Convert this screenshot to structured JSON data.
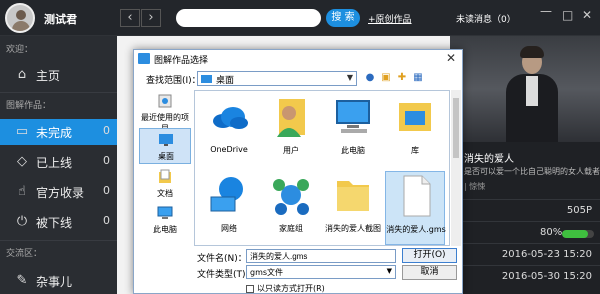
{
  "topbar": {
    "username": "测试君",
    "back_label": "‹",
    "forward_label": "›",
    "search_value": "",
    "search_button": "搜 索",
    "publish_link": "+原创作品",
    "unread": "未读消息（0）",
    "min_label": "—",
    "max_label": "□",
    "close_label": "✕"
  },
  "sidebar": {
    "welcome": "欢迎：",
    "home": "主页",
    "works_section": "图解作品：",
    "items": [
      {
        "label": "未完成",
        "count": "0",
        "icon": "monitor-icon"
      },
      {
        "label": "已上线",
        "count": "0",
        "icon": "tag-icon"
      },
      {
        "label": "官方收录",
        "count": "0",
        "icon": "thumb-up-icon"
      },
      {
        "label": "被下线",
        "count": "0",
        "icon": "power-icon"
      }
    ],
    "exchange_section": "交流区：",
    "misc": "杂事儿"
  },
  "rightpanel": {
    "title": "消失的爱人",
    "desc": "是否可以爱一个比自己聪明的女人载者嫁",
    "tags": "| 惊悚",
    "size": "505P",
    "progress_pct": "80%",
    "progress_value": 0.8,
    "date1": "2016-05-23 15:20",
    "date2": "2016-05-30 15:20"
  },
  "dialog": {
    "title": "图解作品选择",
    "close_label": "✕",
    "lookin_label": "查找范围(I)：",
    "lookin_value": "桌面",
    "places": [
      {
        "label": "最近使用的项目",
        "icon": "recent-icon"
      },
      {
        "label": "桌面",
        "icon": "desktop-icon"
      },
      {
        "label": "文档",
        "icon": "documents-icon"
      },
      {
        "label": "此电脑",
        "icon": "this-pc-icon"
      }
    ],
    "files": [
      {
        "label": "OneDrive",
        "icon": "onedrive-icon"
      },
      {
        "label": "用户",
        "icon": "user-folder-icon"
      },
      {
        "label": "此电脑",
        "icon": "computer-icon"
      },
      {
        "label": "库",
        "icon": "library-icon"
      },
      {
        "label": "网络",
        "icon": "network-icon"
      },
      {
        "label": "家庭组",
        "icon": "homegroup-icon"
      },
      {
        "label": "消失的爱人截图",
        "icon": "folder-icon"
      },
      {
        "label": "消失的爱人.gms",
        "icon": "file-icon"
      }
    ],
    "filename_label": "文件名(N)：",
    "filename_value": "消失的爱人.gms",
    "filetype_label": "文件类型(T)：",
    "filetype_value": "gms文件",
    "open_label": "打开(O)",
    "cancel_label": "取消",
    "readonly_label": "以只读方式打开(R)"
  },
  "colors": {
    "accent": "#1d8fe0",
    "progress": "#3fbf3f"
  }
}
